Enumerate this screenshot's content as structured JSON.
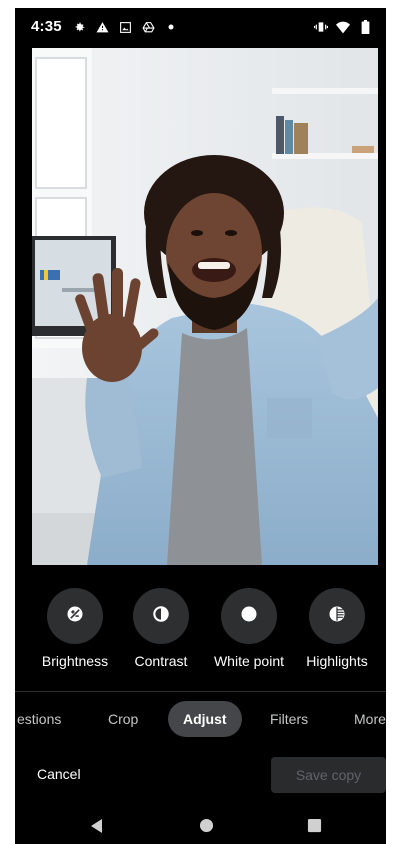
{
  "status_bar": {
    "time": "4:35",
    "left_icons": [
      "settings-icon",
      "warning-icon",
      "image-icon",
      "google-drive-icon",
      "dot-icon"
    ],
    "right_icons": [
      "vibrate-icon",
      "wifi-icon",
      "battery-icon"
    ]
  },
  "photo": {
    "description_icon": "photo-preview"
  },
  "tools": [
    {
      "label": "Brightness",
      "icon": "brightness-icon"
    },
    {
      "label": "Contrast",
      "icon": "contrast-icon"
    },
    {
      "label": "White point",
      "icon": "white-point-icon"
    },
    {
      "label": "Highlights",
      "icon": "highlights-icon"
    }
  ],
  "tabs": [
    {
      "label": "estions",
      "active": false
    },
    {
      "label": "Crop",
      "active": false
    },
    {
      "label": "Adjust",
      "active": true
    },
    {
      "label": "Filters",
      "active": false
    },
    {
      "label": "More",
      "active": false
    }
  ],
  "actions": {
    "cancel_label": "Cancel",
    "save_label": "Save copy"
  },
  "nav": {
    "back_icon": "back-icon",
    "home_icon": "home-icon",
    "recents_icon": "recents-icon"
  },
  "colors": {
    "background": "#000000",
    "tool_circle": "#2d2f31",
    "active_tab": "#444649",
    "save_disabled_bg": "#2a2b2d",
    "save_disabled_text": "#5f6368"
  }
}
